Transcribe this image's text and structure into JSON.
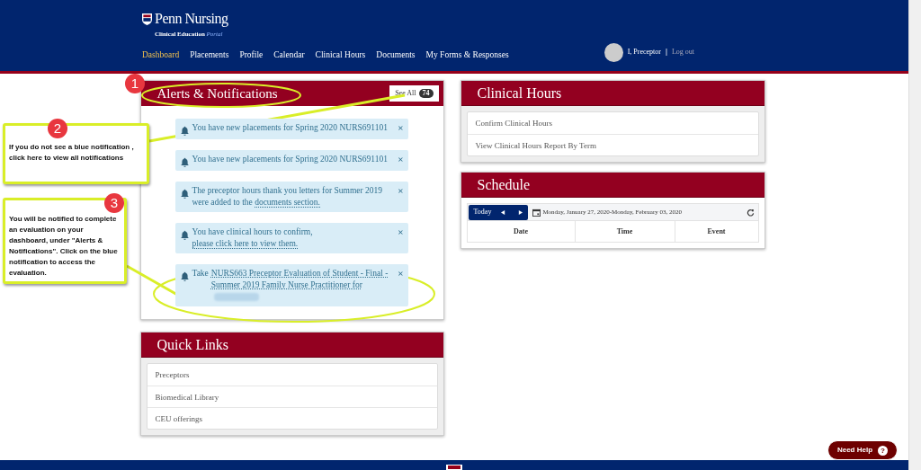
{
  "header": {
    "logo": {
      "name": "Penn Nursing",
      "subtitle": "Clinical Education",
      "subtitle_em": "Portal"
    },
    "nav": [
      {
        "label": "Dashboard",
        "selected": true
      },
      {
        "label": "Placements",
        "selected": false
      },
      {
        "label": "Profile",
        "selected": false
      },
      {
        "label": "Calendar",
        "selected": false
      },
      {
        "label": "Clinical Hours",
        "selected": false
      },
      {
        "label": "Documents",
        "selected": false
      },
      {
        "label": "My Forms & Responses",
        "selected": false
      }
    ],
    "user": {
      "name": "I, Preceptor",
      "separator": "|",
      "logout": "Log out"
    }
  },
  "alerts": {
    "title": "Alerts & Notifications",
    "see_all": "See All",
    "count": "74",
    "notifications": [
      {
        "text": "You have new placements for Spring 2020 NURS691101",
        "redacted": false
      },
      {
        "text": "You have new placements for Spring 2020 NURS691101",
        "redacted": false
      },
      {
        "text": "The preceptor hours thank you letters for Summer 2019 were added to the ",
        "link": "documents section.",
        "redacted": false
      },
      {
        "text": "You have clinical hours to confirm, ",
        "link": "please click here to view them.",
        "redacted": false
      },
      {
        "text": "Take ",
        "link": "NURS663 Preceptor Evaluation of Student - Final - Summer 2019 Family Nurse Practitioner for",
        "redacted": true
      }
    ],
    "close": "×"
  },
  "quick_links": {
    "title": "Quick Links",
    "items": [
      "Preceptors",
      "Biomedical Library",
      "CEU offerings"
    ]
  },
  "clinical_hours": {
    "title": "Clinical Hours",
    "items": [
      "Confirm Clinical Hours",
      "View Clinical Hours Report By Term"
    ]
  },
  "schedule": {
    "title": "Schedule",
    "today": "Today",
    "range": "Monday, January 27, 2020-Monday, February 03, 2020",
    "columns": [
      "Date",
      "Time",
      "Event"
    ]
  },
  "help": {
    "label": "Need Help",
    "icon": "?"
  },
  "annotations": [
    {
      "number": "1"
    },
    {
      "number": "2",
      "text": "If you do not see a blue notification , click here to view all notifications"
    },
    {
      "number": "3",
      "text": "You will be notified to complete an evaluation on your dashboard, under \"Alerts & Notifications\". Click on the blue notification to access the evaluation."
    }
  ]
}
